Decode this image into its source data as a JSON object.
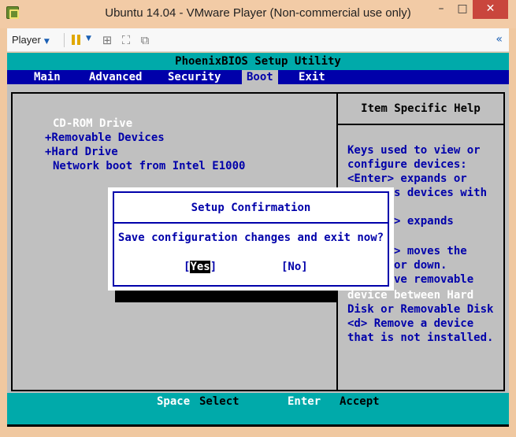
{
  "window": {
    "title": "Ubuntu 14.04 - VMware Player (Non-commercial use only)",
    "minimize": "–",
    "maximize": "□",
    "close": "✕"
  },
  "toolbar": {
    "player_label": "Player",
    "player_chevron": "▼",
    "pause_chevron": "▼",
    "network_glyph": "⊞",
    "fullscreen_glyph": "⛶",
    "unity_glyph": "⧉",
    "collapse_glyph": "«"
  },
  "bios": {
    "title": "PhoenixBIOS Setup Utility",
    "menu": [
      "Main",
      "Advanced",
      "Security",
      "Boot",
      "Exit"
    ],
    "active_menu": "Boot",
    "boot_items": [
      "CD-ROM Drive",
      "+Removable Devices",
      "+Hard Drive",
      "Network boot from Intel E1000"
    ],
    "help_title": "Item Specific Help",
    "help_lines": [
      "Keys used to view or",
      "configure devices:",
      "<Enter> expands or",
      "       s devices with",
      "",
      "     er> expands",
      "",
      "     <-> moves the",
      "     p or down.",
      "      ove removable",
      "device between Hard",
      "Disk or Removable Disk",
      "<d> Remove a device",
      "that is not installed."
    ],
    "footer": {
      "key1": "Space",
      "action1": "Select",
      "key2": "Enter",
      "action2": "Accept"
    }
  },
  "dialog": {
    "title": "Setup Confirmation",
    "message": "Save configuration changes and exit now?",
    "yes_open": "[",
    "yes_label": "Yes",
    "yes_close": "]",
    "no_label": "[No]"
  }
}
